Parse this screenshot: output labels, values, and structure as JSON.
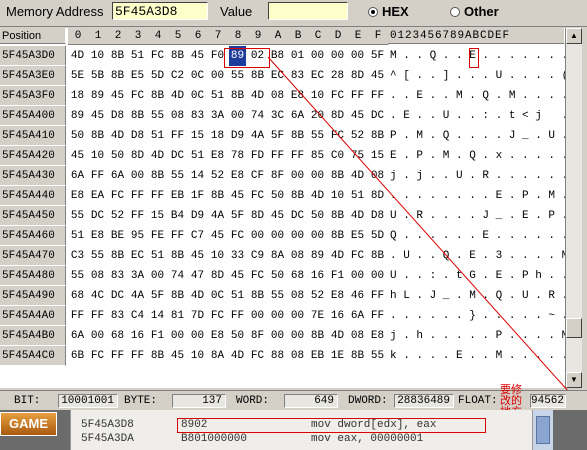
{
  "topbar": {
    "address_label": "Memory Address",
    "address_value": "5F45A3D8",
    "value_label": "Value",
    "value_value": "",
    "hex_label": "HEX",
    "other_label": "Other",
    "selected": "HEX"
  },
  "grid": {
    "position_header": "Position",
    "byte_headers": [
      "0",
      "1",
      "2",
      "3",
      "4",
      "5",
      "6",
      "7",
      "8",
      "9",
      "A",
      "B",
      "C",
      "D",
      "E",
      "F"
    ],
    "ascii_header": "0123456789ABCDEF",
    "rows": [
      {
        "addr": "5F45A3D0",
        "bytes": [
          "4D",
          "10",
          "8B",
          "51",
          "FC",
          "8B",
          "45",
          "F0",
          "89",
          "02",
          "B8",
          "01",
          "00",
          "00",
          "00",
          "5F"
        ],
        "ascii": "M . . Q . . E . . . . . . . . _"
      },
      {
        "addr": "5F45A3E0",
        "bytes": [
          "5E",
          "5B",
          "8B",
          "E5",
          "5D",
          "C2",
          "0C",
          "00",
          "55",
          "8B",
          "EC",
          "83",
          "EC",
          "28",
          "8D",
          "45"
        ],
        "ascii": "^ [ . . ] . . . U . . . . ( . E"
      },
      {
        "addr": "5F45A3F0",
        "bytes": [
          "18",
          "89",
          "45",
          "FC",
          "8B",
          "4D",
          "0C",
          "51",
          "8B",
          "4D",
          "08",
          "E8",
          "10",
          "FC",
          "FF",
          "FF"
        ],
        "ascii": ". . E . . M . Q . M . . . . . ."
      },
      {
        "addr": "5F45A400",
        "bytes": [
          "89",
          "45",
          "D8",
          "8B",
          "55",
          "08",
          "83",
          "3A",
          "00",
          "74",
          "3C",
          "6A",
          "20",
          "8D",
          "45",
          "DC"
        ],
        "ascii": ". E . . U . . : . t < j   . E ."
      },
      {
        "addr": "5F45A410",
        "bytes": [
          "50",
          "8B",
          "4D",
          "D8",
          "51",
          "FF",
          "15",
          "18",
          "D9",
          "4A",
          "5F",
          "8B",
          "55",
          "FC",
          "52",
          "8B"
        ],
        "ascii": "P . M . Q . . . . J _ . U . R ."
      },
      {
        "addr": "5F45A420",
        "bytes": [
          "45",
          "10",
          "50",
          "8D",
          "4D",
          "DC",
          "51",
          "E8",
          "78",
          "FD",
          "FF",
          "FF",
          "85",
          "C0",
          "75",
          "15"
        ],
        "ascii": "E . P . M . Q . x . . . . . u ."
      },
      {
        "addr": "5F45A430",
        "bytes": [
          "6A",
          "FF",
          "6A",
          "00",
          "8B",
          "55",
          "14",
          "52",
          "E8",
          "CF",
          "8F",
          "00",
          "00",
          "8B",
          "4D",
          "08"
        ],
        "ascii": "j . j . . U . R . . . . . . M ."
      },
      {
        "addr": "5F45A440",
        "bytes": [
          "E8",
          "EA",
          "FC",
          "FF",
          "FF",
          "EB",
          "1F",
          "8B",
          "45",
          "FC",
          "50",
          "8B",
          "4D",
          "10",
          "51",
          "8D"
        ],
        "ascii": ". . . . . . . . E . P . M . Q ."
      },
      {
        "addr": "5F45A450",
        "bytes": [
          "55",
          "DC",
          "52",
          "FF",
          "15",
          "B4",
          "D9",
          "4A",
          "5F",
          "8D",
          "45",
          "DC",
          "50",
          "8B",
          "4D",
          "D8"
        ],
        "ascii": "U . R . . . . J _ . E . P . M ."
      },
      {
        "addr": "5F45A460",
        "bytes": [
          "51",
          "E8",
          "BE",
          "95",
          "FE",
          "FF",
          "C7",
          "45",
          "FC",
          "00",
          "00",
          "00",
          "00",
          "8B",
          "E5",
          "5D"
        ],
        "ascii": "Q . . . . . . E . . . . . . . ]"
      },
      {
        "addr": "5F45A470",
        "bytes": [
          "C3",
          "55",
          "8B",
          "EC",
          "51",
          "8B",
          "45",
          "10",
          "33",
          "C9",
          "8A",
          "08",
          "89",
          "4D",
          "FC",
          "8B"
        ],
        "ascii": ". U . . Q . E . 3 . . . . M . ."
      },
      {
        "addr": "5F45A480",
        "bytes": [
          "55",
          "08",
          "83",
          "3A",
          "00",
          "74",
          "47",
          "8D",
          "45",
          "FC",
          "50",
          "68",
          "16",
          "F1",
          "00",
          "00"
        ],
        "ascii": "U . . : . t G . E . P h . . . ."
      },
      {
        "addr": "5F45A490",
        "bytes": [
          "68",
          "4C",
          "DC",
          "4A",
          "5F",
          "8B",
          "4D",
          "0C",
          "51",
          "8B",
          "55",
          "08",
          "52",
          "E8",
          "46",
          "FF"
        ],
        "ascii": "h L . J _ . M . Q . U . R . F ."
      },
      {
        "addr": "5F45A4A0",
        "bytes": [
          "FF",
          "FF",
          "83",
          "C4",
          "14",
          "81",
          "7D",
          "FC",
          "FF",
          "00",
          "00",
          "00",
          "7E",
          "16",
          "6A",
          "FF"
        ],
        "ascii": ". . . . . . } . . . . . ~ . j ."
      },
      {
        "addr": "5F45A4B0",
        "bytes": [
          "6A",
          "00",
          "68",
          "16",
          "F1",
          "00",
          "00",
          "E8",
          "50",
          "8F",
          "00",
          "00",
          "8B",
          "4D",
          "08",
          "E8"
        ],
        "ascii": "j . h . . . . . P . . . . M . ."
      },
      {
        "addr": "5F45A4C0",
        "bytes": [
          "6B",
          "FC",
          "FF",
          "FF",
          "8B",
          "45",
          "10",
          "8A",
          "4D",
          "FC",
          "88",
          "08",
          "EB",
          "1E",
          "8B",
          "55"
        ],
        "ascii": "k . . . . E . . M . . . . . . U"
      }
    ]
  },
  "status": {
    "bit_label": "BIT:",
    "bit_value": "10001001",
    "byte_label": "BYTE:",
    "byte_value": "137",
    "word_label": "WORD:",
    "word_value": "649",
    "dword_label": "DWORD:",
    "dword_value": "28836489",
    "float_label": "FLOAT:",
    "float_value": "94562"
  },
  "annotation": "要修改的地方",
  "bottom": {
    "game_button": "GAME",
    "disasm": [
      {
        "addr": "5F45A3D8",
        "bytes": "8902",
        "instr": "mov dword[edx], eax"
      },
      {
        "addr": "5F45A3DA",
        "bytes": "B801000000",
        "instr": "mov eax, 00000001"
      },
      {
        "addr": "",
        "bytes": "",
        "instr": ""
      }
    ]
  },
  "colors": {
    "highlight": "#1e3c9c",
    "marker": "#dd0000",
    "field_bg": "#ffffcc"
  }
}
